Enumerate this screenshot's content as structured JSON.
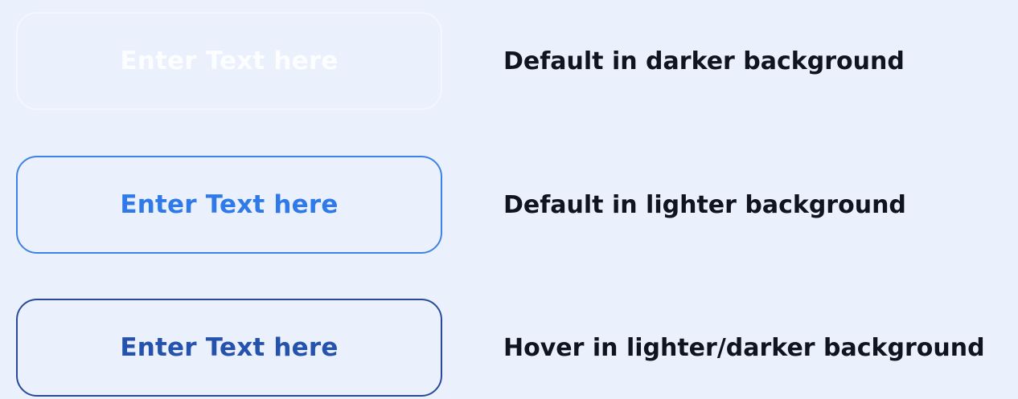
{
  "variants": [
    {
      "button_label": "Enter Text here",
      "description": "Default in darker background"
    },
    {
      "button_label": "Enter Text here",
      "description": "Default in lighter background"
    },
    {
      "button_label": "Enter Text here",
      "description": "Hover in lighter/darker background"
    }
  ],
  "colors": {
    "background": "#eaf1fc",
    "dark_default_border": "#f3f7fd",
    "dark_default_text": "#fbfdff",
    "light_default_border": "#3f82e6",
    "light_default_text": "#2f7ae8",
    "hover_border": "#284a99",
    "hover_text": "#2552ad",
    "description_text": "#0f1420"
  }
}
